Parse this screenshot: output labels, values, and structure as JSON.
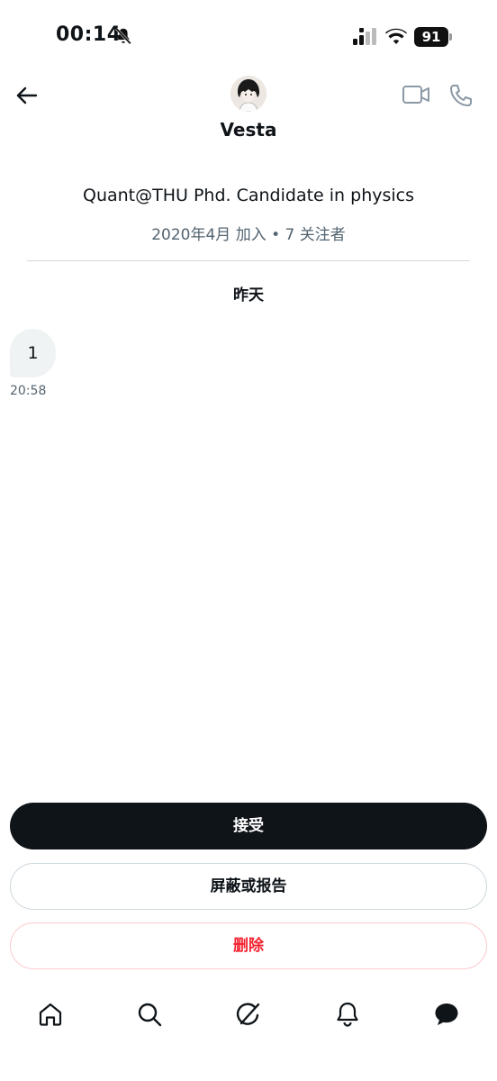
{
  "status_bar": {
    "time": "00:14",
    "battery": "91",
    "icons": [
      "bell-muted-icon",
      "signal-icon",
      "wifi-icon",
      "battery-icon"
    ]
  },
  "header": {
    "user_name": "Vesta",
    "icons": [
      "back-arrow-icon",
      "video-call-icon",
      "phone-call-icon"
    ]
  },
  "profile": {
    "bio": "Quant@THU Phd. Candidate in physics",
    "meta": "2020年4月 加入 • 7 关注者"
  },
  "conversation": {
    "date_label": "昨天",
    "messages": [
      {
        "text": "1",
        "time": "20:58"
      }
    ]
  },
  "actions": {
    "accept_label": "接受",
    "block_label": "屏蔽或报告",
    "delete_label": "删除"
  },
  "bottom_nav": {
    "items": [
      "home-icon",
      "search-icon",
      "grok-icon",
      "notifications-icon",
      "messages-icon"
    ]
  },
  "colors": {
    "primary_text": "#0f1419",
    "secondary_text": "#536471",
    "danger": "#f4212e",
    "bubble_bg": "#eff3f4",
    "divider": "#cfd9de"
  }
}
